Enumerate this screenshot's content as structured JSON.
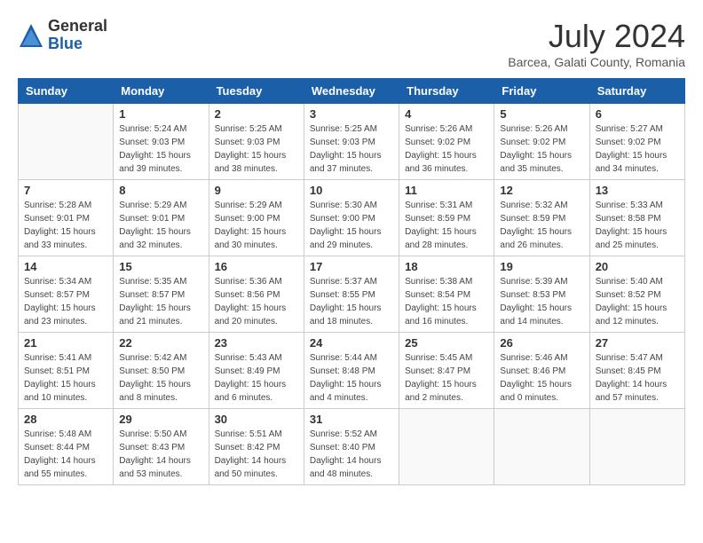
{
  "logo": {
    "general": "General",
    "blue": "Blue"
  },
  "title": "July 2024",
  "subtitle": "Barcea, Galati County, Romania",
  "weekdays": [
    "Sunday",
    "Monday",
    "Tuesday",
    "Wednesday",
    "Thursday",
    "Friday",
    "Saturday"
  ],
  "weeks": [
    [
      {
        "day": "",
        "info": ""
      },
      {
        "day": "1",
        "info": "Sunrise: 5:24 AM\nSunset: 9:03 PM\nDaylight: 15 hours\nand 39 minutes."
      },
      {
        "day": "2",
        "info": "Sunrise: 5:25 AM\nSunset: 9:03 PM\nDaylight: 15 hours\nand 38 minutes."
      },
      {
        "day": "3",
        "info": "Sunrise: 5:25 AM\nSunset: 9:03 PM\nDaylight: 15 hours\nand 37 minutes."
      },
      {
        "day": "4",
        "info": "Sunrise: 5:26 AM\nSunset: 9:02 PM\nDaylight: 15 hours\nand 36 minutes."
      },
      {
        "day": "5",
        "info": "Sunrise: 5:26 AM\nSunset: 9:02 PM\nDaylight: 15 hours\nand 35 minutes."
      },
      {
        "day": "6",
        "info": "Sunrise: 5:27 AM\nSunset: 9:02 PM\nDaylight: 15 hours\nand 34 minutes."
      }
    ],
    [
      {
        "day": "7",
        "info": "Sunrise: 5:28 AM\nSunset: 9:01 PM\nDaylight: 15 hours\nand 33 minutes."
      },
      {
        "day": "8",
        "info": "Sunrise: 5:29 AM\nSunset: 9:01 PM\nDaylight: 15 hours\nand 32 minutes."
      },
      {
        "day": "9",
        "info": "Sunrise: 5:29 AM\nSunset: 9:00 PM\nDaylight: 15 hours\nand 30 minutes."
      },
      {
        "day": "10",
        "info": "Sunrise: 5:30 AM\nSunset: 9:00 PM\nDaylight: 15 hours\nand 29 minutes."
      },
      {
        "day": "11",
        "info": "Sunrise: 5:31 AM\nSunset: 8:59 PM\nDaylight: 15 hours\nand 28 minutes."
      },
      {
        "day": "12",
        "info": "Sunrise: 5:32 AM\nSunset: 8:59 PM\nDaylight: 15 hours\nand 26 minutes."
      },
      {
        "day": "13",
        "info": "Sunrise: 5:33 AM\nSunset: 8:58 PM\nDaylight: 15 hours\nand 25 minutes."
      }
    ],
    [
      {
        "day": "14",
        "info": "Sunrise: 5:34 AM\nSunset: 8:57 PM\nDaylight: 15 hours\nand 23 minutes."
      },
      {
        "day": "15",
        "info": "Sunrise: 5:35 AM\nSunset: 8:57 PM\nDaylight: 15 hours\nand 21 minutes."
      },
      {
        "day": "16",
        "info": "Sunrise: 5:36 AM\nSunset: 8:56 PM\nDaylight: 15 hours\nand 20 minutes."
      },
      {
        "day": "17",
        "info": "Sunrise: 5:37 AM\nSunset: 8:55 PM\nDaylight: 15 hours\nand 18 minutes."
      },
      {
        "day": "18",
        "info": "Sunrise: 5:38 AM\nSunset: 8:54 PM\nDaylight: 15 hours\nand 16 minutes."
      },
      {
        "day": "19",
        "info": "Sunrise: 5:39 AM\nSunset: 8:53 PM\nDaylight: 15 hours\nand 14 minutes."
      },
      {
        "day": "20",
        "info": "Sunrise: 5:40 AM\nSunset: 8:52 PM\nDaylight: 15 hours\nand 12 minutes."
      }
    ],
    [
      {
        "day": "21",
        "info": "Sunrise: 5:41 AM\nSunset: 8:51 PM\nDaylight: 15 hours\nand 10 minutes."
      },
      {
        "day": "22",
        "info": "Sunrise: 5:42 AM\nSunset: 8:50 PM\nDaylight: 15 hours\nand 8 minutes."
      },
      {
        "day": "23",
        "info": "Sunrise: 5:43 AM\nSunset: 8:49 PM\nDaylight: 15 hours\nand 6 minutes."
      },
      {
        "day": "24",
        "info": "Sunrise: 5:44 AM\nSunset: 8:48 PM\nDaylight: 15 hours\nand 4 minutes."
      },
      {
        "day": "25",
        "info": "Sunrise: 5:45 AM\nSunset: 8:47 PM\nDaylight: 15 hours\nand 2 minutes."
      },
      {
        "day": "26",
        "info": "Sunrise: 5:46 AM\nSunset: 8:46 PM\nDaylight: 15 hours\nand 0 minutes."
      },
      {
        "day": "27",
        "info": "Sunrise: 5:47 AM\nSunset: 8:45 PM\nDaylight: 14 hours\nand 57 minutes."
      }
    ],
    [
      {
        "day": "28",
        "info": "Sunrise: 5:48 AM\nSunset: 8:44 PM\nDaylight: 14 hours\nand 55 minutes."
      },
      {
        "day": "29",
        "info": "Sunrise: 5:50 AM\nSunset: 8:43 PM\nDaylight: 14 hours\nand 53 minutes."
      },
      {
        "day": "30",
        "info": "Sunrise: 5:51 AM\nSunset: 8:42 PM\nDaylight: 14 hours\nand 50 minutes."
      },
      {
        "day": "31",
        "info": "Sunrise: 5:52 AM\nSunset: 8:40 PM\nDaylight: 14 hours\nand 48 minutes."
      },
      {
        "day": "",
        "info": ""
      },
      {
        "day": "",
        "info": ""
      },
      {
        "day": "",
        "info": ""
      }
    ]
  ]
}
